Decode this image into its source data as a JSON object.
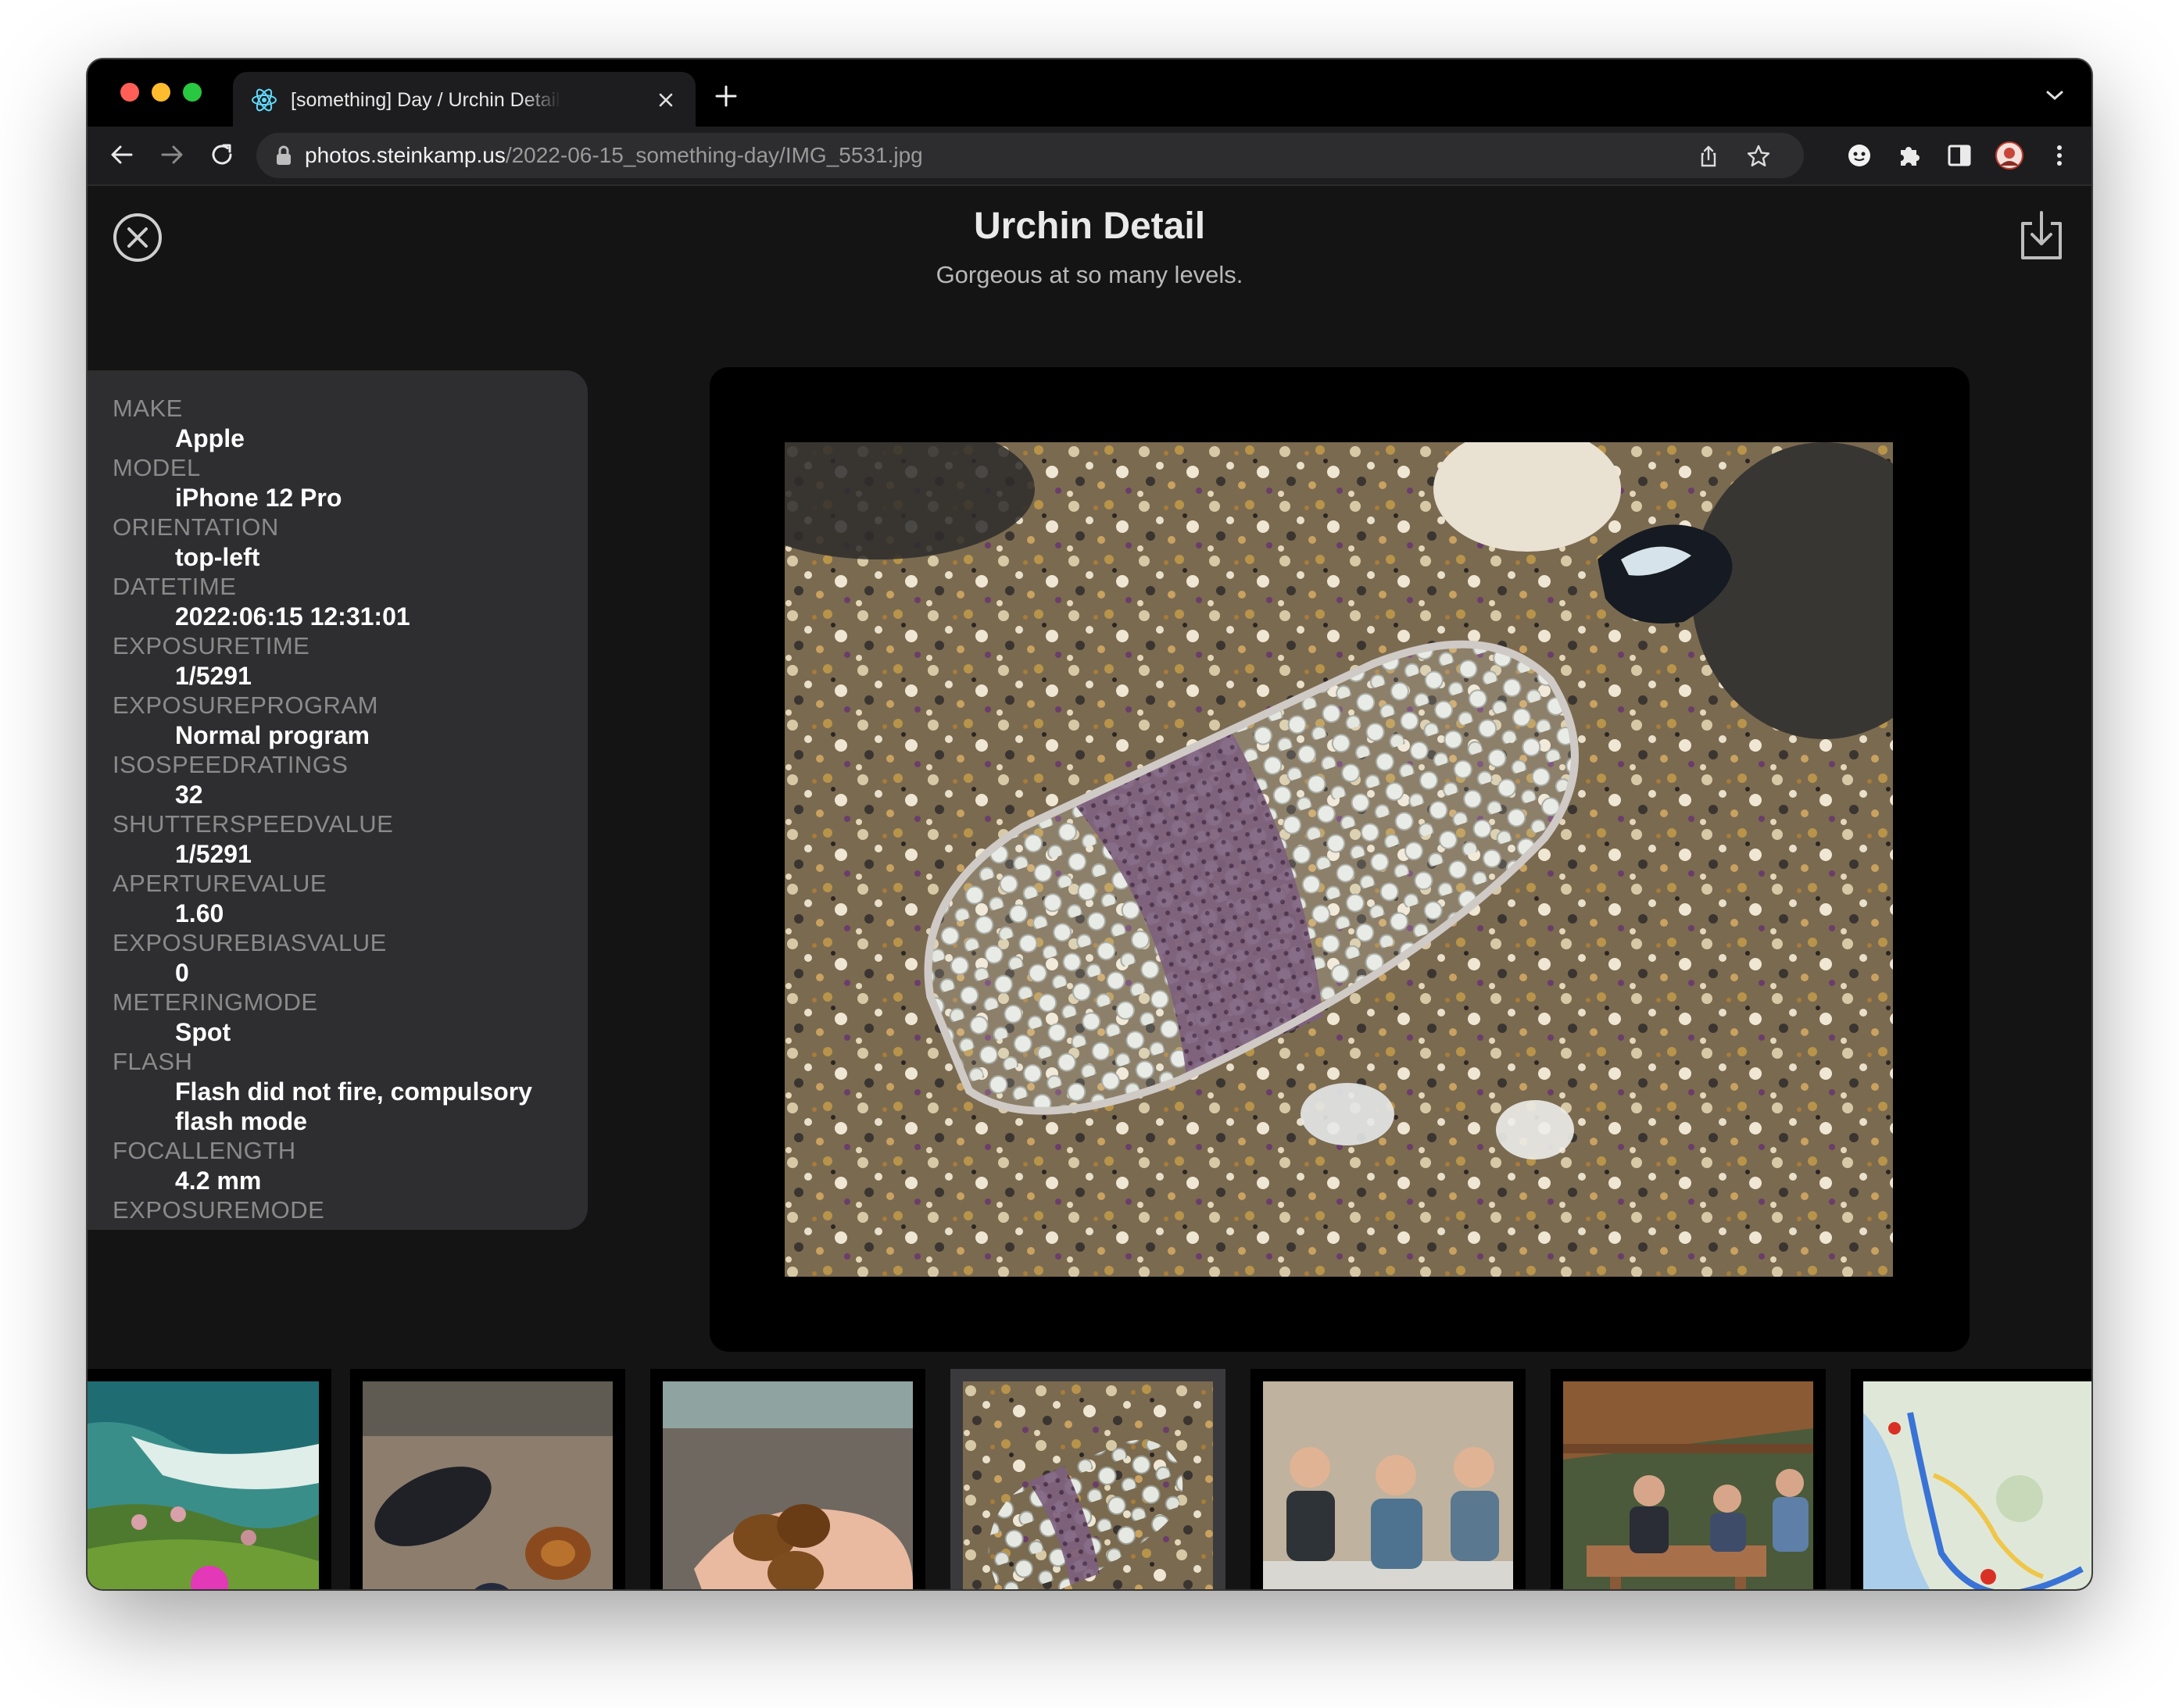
{
  "browser": {
    "tab": {
      "title": "[something] Day / Urchin Detail"
    },
    "url": {
      "host": "photos.steinkamp.us",
      "path": "/2022-06-15_something-day/IMG_5531.jpg"
    }
  },
  "page": {
    "title": "Urchin Detail",
    "subtitle": "Gorgeous at so many levels."
  },
  "exif": [
    {
      "key": "MAKE",
      "value": "Apple"
    },
    {
      "key": "MODEL",
      "value": "iPhone 12 Pro"
    },
    {
      "key": "ORIENTATION",
      "value": "top-left"
    },
    {
      "key": "DATETIME",
      "value": "2022:06:15 12:31:01"
    },
    {
      "key": "EXPOSURETIME",
      "value": "1/5291"
    },
    {
      "key": "EXPOSUREPROGRAM",
      "value": "Normal program"
    },
    {
      "key": "ISOSPEEDRATINGS",
      "value": "32"
    },
    {
      "key": "SHUTTERSPEEDVALUE",
      "value": "1/5291"
    },
    {
      "key": "APERTUREVALUE",
      "value": "1.60"
    },
    {
      "key": "EXPOSUREBIASVALUE",
      "value": "0"
    },
    {
      "key": "METERINGMODE",
      "value": "Spot"
    },
    {
      "key": "FLASH",
      "value": "Flash did not fire, compulsory flash mode"
    },
    {
      "key": "FOCALLENGTH",
      "value": "4.2 mm"
    },
    {
      "key": "EXPOSUREMODE",
      "value": ""
    }
  ],
  "filmstrip": {
    "thumbnails": [
      {
        "subject": "coastal flowers and surf"
      },
      {
        "subject": "mussels and snails on sand"
      },
      {
        "subject": "snail shells in hand"
      },
      {
        "subject": "urchin test on sand",
        "active": true
      },
      {
        "subject": "three hikers sitting"
      },
      {
        "subject": "group at picnic table"
      },
      {
        "subject": "map of bay area"
      }
    ]
  },
  "icons": {
    "tab_favicon": "react-atom-icon",
    "close": "close-circle-icon",
    "download": "download-icon"
  },
  "colors": {
    "background": "#141414",
    "panel": "#2e2e30",
    "viewer": "#000000"
  }
}
